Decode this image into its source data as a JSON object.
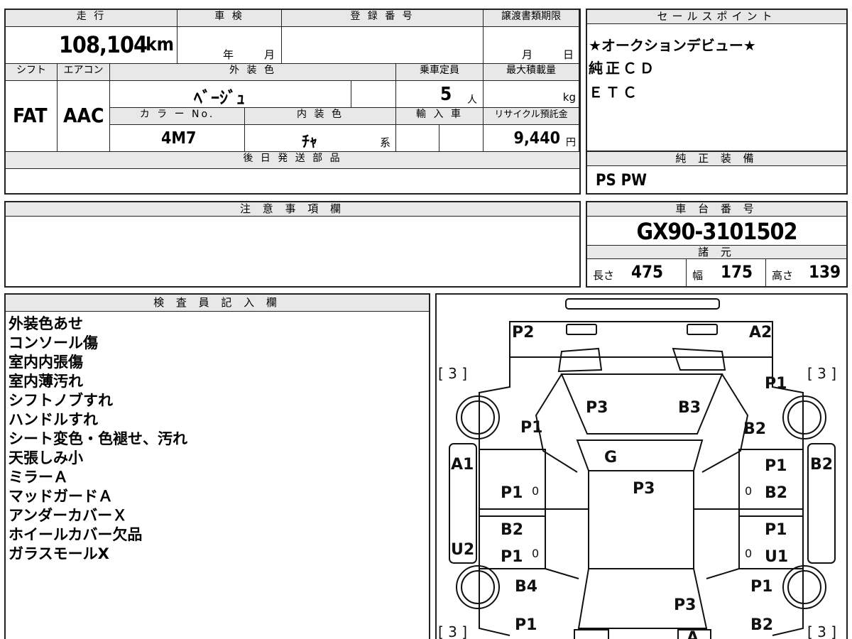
{
  "top": {
    "mileage_label": "走 行",
    "mileage_value": "108,104",
    "mileage_unit": "km",
    "inspection_label": "車 検",
    "inspection_year": "年",
    "inspection_month": "月",
    "reg_label": "登 録 番 号",
    "deadline_label": "譲渡書類期限",
    "deadline_month": "月",
    "deadline_day": "日",
    "shift_label": "シフト",
    "shift_value": "FAT",
    "ac_label": "エアコン",
    "ac_value": "AAC",
    "ext_color_label": "外 装 色",
    "ext_color_value": "ﾍﾞｰｼﾞｭ",
    "capacity_label": "乗車定員",
    "capacity_value": "5",
    "capacity_unit": "人",
    "maxload_label": "最大積載量",
    "maxload_unit": "kg",
    "colorno_label": "カ ラ ー No.",
    "colorno_value": "4M7",
    "int_color_label": "内 装 色",
    "int_color_value": "ﾁｬ",
    "int_color_suffix": "系",
    "import_label": "輸 入 車",
    "recycle_label": "リサイクル預託金",
    "recycle_value": "9,440",
    "recycle_unit": "円",
    "later_parts_label": "後 日 発 送 部 品"
  },
  "sales": {
    "header": "セールスポイント",
    "lines": [
      "★オークションデビュー★",
      "純正ＣＤ",
      "ＥＴＣ"
    ]
  },
  "equipment": {
    "header": "純 正 装 備",
    "value": "PS PW"
  },
  "notes": {
    "header": "注 意 事 項 欄"
  },
  "chassis": {
    "header": "車 台 番 号",
    "value": "GX90-3101502",
    "specs_header": "諸 元",
    "length_label": "長さ",
    "length_value": "475",
    "width_label": "幅",
    "width_value": "175",
    "height_label": "高さ",
    "height_value": "139"
  },
  "inspector": {
    "header": "検 査 員 記 入 欄",
    "lines": [
      "外装色あせ",
      "コンソール傷",
      "室内内張傷",
      "室内薄汚れ",
      "シフトノブすれ",
      "ハンドルすれ",
      "シート変色・色褪せ、汚れ",
      "天張しみ小",
      "ミラーＡ",
      "マッドガードＡ",
      "アンダーカバーＸ",
      "ホイールカバー欠品",
      "ガラスモールX"
    ]
  },
  "diagram": {
    "bracket_tl": "[ 3 ]",
    "bracket_tr": "[ 3 ]",
    "bracket_bl": "[ 3 ]",
    "bracket_br": "[ 3 ]",
    "marks": {
      "p2_tl": "P2",
      "a2_tr": "A2",
      "p3_hood": "P3",
      "b3_hood": "B3",
      "p1_left_fender": "P1",
      "p1_right_fender_top": "P1",
      "b2_right_fender": "B2",
      "g_windshield": "G",
      "a1_left": "A1",
      "b2_right_edge": "B2",
      "p1_left_door1": "P1",
      "p1_right_door1": "P1",
      "b2_right_door1": "B2",
      "p3_roof": "P3",
      "b2_left_door2": "B2",
      "p1_left_door2": "P1",
      "u2_left": "U2",
      "p1_right_door2": "P1",
      "u1_right": "U1",
      "b4_left_rear": "B4",
      "p1_right_rear": "P1",
      "p3_trunk": "P3",
      "p1_left_bottom": "P1",
      "b2_right_bottom": "B2",
      "a_bottom": "A",
      "zero_l1": "0",
      "zero_r1": "0",
      "zero_l2": "0",
      "zero_r2": "0"
    }
  }
}
